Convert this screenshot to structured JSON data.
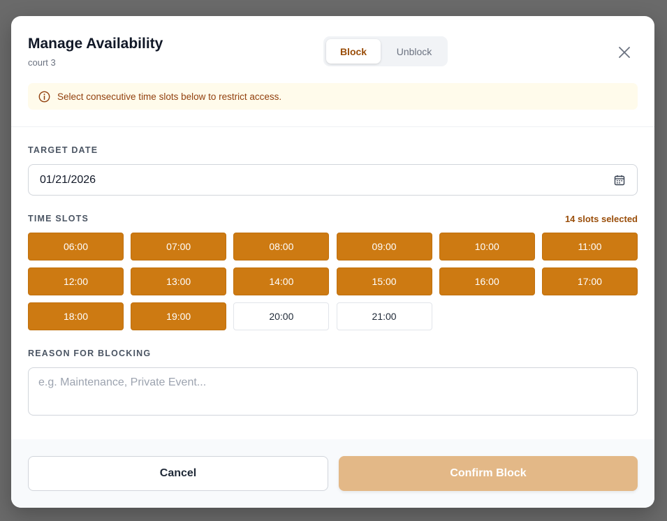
{
  "modal": {
    "title": "Manage Availability",
    "subtitle": "court 3",
    "close_icon": "close-icon"
  },
  "mode_toggle": {
    "block_label": "Block",
    "unblock_label": "Unblock",
    "active": "Block"
  },
  "notice": {
    "icon": "info-icon",
    "text": "Select consecutive time slots below to restrict access."
  },
  "target_date": {
    "label": "TARGET DATE",
    "value": "01/21/2026",
    "icon": "calendar-icon"
  },
  "time_slots": {
    "label": "TIME SLOTS",
    "selected_count_text": "14 slots selected",
    "slots": [
      {
        "time": "06:00",
        "selected": true
      },
      {
        "time": "07:00",
        "selected": true
      },
      {
        "time": "08:00",
        "selected": true
      },
      {
        "time": "09:00",
        "selected": true
      },
      {
        "time": "10:00",
        "selected": true
      },
      {
        "time": "11:00",
        "selected": true
      },
      {
        "time": "12:00",
        "selected": true
      },
      {
        "time": "13:00",
        "selected": true
      },
      {
        "time": "14:00",
        "selected": true
      },
      {
        "time": "15:00",
        "selected": true
      },
      {
        "time": "16:00",
        "selected": true
      },
      {
        "time": "17:00",
        "selected": true
      },
      {
        "time": "18:00",
        "selected": true
      },
      {
        "time": "19:00",
        "selected": true
      },
      {
        "time": "20:00",
        "selected": false
      },
      {
        "time": "21:00",
        "selected": false
      }
    ]
  },
  "reason": {
    "label": "REASON FOR BLOCKING",
    "placeholder": "e.g. Maintenance, Private Event...",
    "value": ""
  },
  "footer": {
    "cancel_label": "Cancel",
    "confirm_label": "Confirm Block"
  },
  "colors": {
    "accent": "#cd7a12",
    "accent_text": "#9a4e0a",
    "confirm_disabled": "#e3b887",
    "notice_bg": "#fffbeb"
  }
}
